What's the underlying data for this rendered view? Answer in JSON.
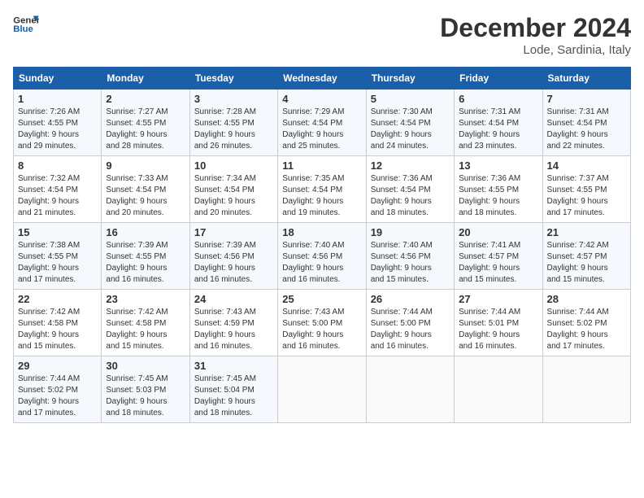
{
  "header": {
    "logo_line1": "General",
    "logo_line2": "Blue",
    "month_title": "December 2024",
    "location": "Lode, Sardinia, Italy"
  },
  "weekdays": [
    "Sunday",
    "Monday",
    "Tuesday",
    "Wednesday",
    "Thursday",
    "Friday",
    "Saturday"
  ],
  "weeks": [
    [
      {
        "day": "1",
        "info": "Sunrise: 7:26 AM\nSunset: 4:55 PM\nDaylight: 9 hours\nand 29 minutes."
      },
      {
        "day": "2",
        "info": "Sunrise: 7:27 AM\nSunset: 4:55 PM\nDaylight: 9 hours\nand 28 minutes."
      },
      {
        "day": "3",
        "info": "Sunrise: 7:28 AM\nSunset: 4:55 PM\nDaylight: 9 hours\nand 26 minutes."
      },
      {
        "day": "4",
        "info": "Sunrise: 7:29 AM\nSunset: 4:54 PM\nDaylight: 9 hours\nand 25 minutes."
      },
      {
        "day": "5",
        "info": "Sunrise: 7:30 AM\nSunset: 4:54 PM\nDaylight: 9 hours\nand 24 minutes."
      },
      {
        "day": "6",
        "info": "Sunrise: 7:31 AM\nSunset: 4:54 PM\nDaylight: 9 hours\nand 23 minutes."
      },
      {
        "day": "7",
        "info": "Sunrise: 7:31 AM\nSunset: 4:54 PM\nDaylight: 9 hours\nand 22 minutes."
      }
    ],
    [
      {
        "day": "8",
        "info": "Sunrise: 7:32 AM\nSunset: 4:54 PM\nDaylight: 9 hours\nand 21 minutes."
      },
      {
        "day": "9",
        "info": "Sunrise: 7:33 AM\nSunset: 4:54 PM\nDaylight: 9 hours\nand 20 minutes."
      },
      {
        "day": "10",
        "info": "Sunrise: 7:34 AM\nSunset: 4:54 PM\nDaylight: 9 hours\nand 20 minutes."
      },
      {
        "day": "11",
        "info": "Sunrise: 7:35 AM\nSunset: 4:54 PM\nDaylight: 9 hours\nand 19 minutes."
      },
      {
        "day": "12",
        "info": "Sunrise: 7:36 AM\nSunset: 4:54 PM\nDaylight: 9 hours\nand 18 minutes."
      },
      {
        "day": "13",
        "info": "Sunrise: 7:36 AM\nSunset: 4:55 PM\nDaylight: 9 hours\nand 18 minutes."
      },
      {
        "day": "14",
        "info": "Sunrise: 7:37 AM\nSunset: 4:55 PM\nDaylight: 9 hours\nand 17 minutes."
      }
    ],
    [
      {
        "day": "15",
        "info": "Sunrise: 7:38 AM\nSunset: 4:55 PM\nDaylight: 9 hours\nand 17 minutes."
      },
      {
        "day": "16",
        "info": "Sunrise: 7:39 AM\nSunset: 4:55 PM\nDaylight: 9 hours\nand 16 minutes."
      },
      {
        "day": "17",
        "info": "Sunrise: 7:39 AM\nSunset: 4:56 PM\nDaylight: 9 hours\nand 16 minutes."
      },
      {
        "day": "18",
        "info": "Sunrise: 7:40 AM\nSunset: 4:56 PM\nDaylight: 9 hours\nand 16 minutes."
      },
      {
        "day": "19",
        "info": "Sunrise: 7:40 AM\nSunset: 4:56 PM\nDaylight: 9 hours\nand 15 minutes."
      },
      {
        "day": "20",
        "info": "Sunrise: 7:41 AM\nSunset: 4:57 PM\nDaylight: 9 hours\nand 15 minutes."
      },
      {
        "day": "21",
        "info": "Sunrise: 7:42 AM\nSunset: 4:57 PM\nDaylight: 9 hours\nand 15 minutes."
      }
    ],
    [
      {
        "day": "22",
        "info": "Sunrise: 7:42 AM\nSunset: 4:58 PM\nDaylight: 9 hours\nand 15 minutes."
      },
      {
        "day": "23",
        "info": "Sunrise: 7:42 AM\nSunset: 4:58 PM\nDaylight: 9 hours\nand 15 minutes."
      },
      {
        "day": "24",
        "info": "Sunrise: 7:43 AM\nSunset: 4:59 PM\nDaylight: 9 hours\nand 16 minutes."
      },
      {
        "day": "25",
        "info": "Sunrise: 7:43 AM\nSunset: 5:00 PM\nDaylight: 9 hours\nand 16 minutes."
      },
      {
        "day": "26",
        "info": "Sunrise: 7:44 AM\nSunset: 5:00 PM\nDaylight: 9 hours\nand 16 minutes."
      },
      {
        "day": "27",
        "info": "Sunrise: 7:44 AM\nSunset: 5:01 PM\nDaylight: 9 hours\nand 16 minutes."
      },
      {
        "day": "28",
        "info": "Sunrise: 7:44 AM\nSunset: 5:02 PM\nDaylight: 9 hours\nand 17 minutes."
      }
    ],
    [
      {
        "day": "29",
        "info": "Sunrise: 7:44 AM\nSunset: 5:02 PM\nDaylight: 9 hours\nand 17 minutes."
      },
      {
        "day": "30",
        "info": "Sunrise: 7:45 AM\nSunset: 5:03 PM\nDaylight: 9 hours\nand 18 minutes."
      },
      {
        "day": "31",
        "info": "Sunrise: 7:45 AM\nSunset: 5:04 PM\nDaylight: 9 hours\nand 18 minutes."
      },
      {
        "day": "",
        "info": ""
      },
      {
        "day": "",
        "info": ""
      },
      {
        "day": "",
        "info": ""
      },
      {
        "day": "",
        "info": ""
      }
    ]
  ]
}
